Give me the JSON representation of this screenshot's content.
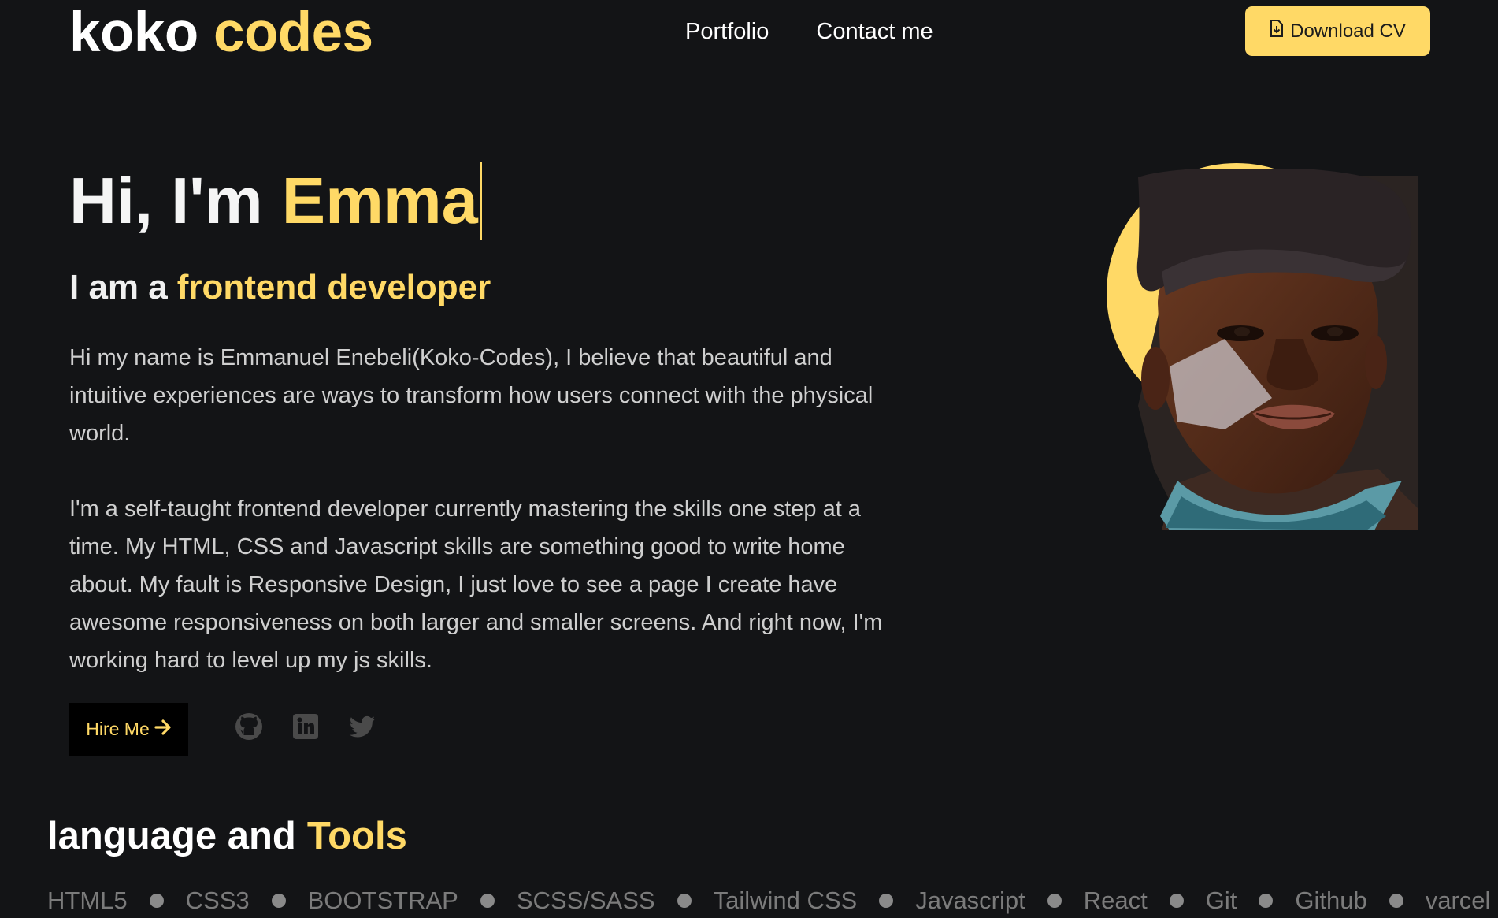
{
  "header": {
    "logo_first": "koko",
    "logo_accent": "codes",
    "nav": [
      "Portfolio",
      "Contact me"
    ],
    "cv_button": "Download CV"
  },
  "hero": {
    "greeting": "Hi, I'm",
    "typed_name": "Emma",
    "role_prefix": "I am a",
    "role": "frontend developer",
    "bio_1": "Hi my name is Emmanuel Enebeli(Koko-Codes), I believe that beautiful and intuitive experiences are ways to transform how users connect with the physical world.",
    "bio_2": "I'm a self-taught frontend developer currently mastering the skills one step at a time. My HTML, CSS and Javascript skills are something good to write home about. My fault is Responsive Design, I just love to see a page I create have awesome responsiveness on both larger and smaller screens. And right now, I'm working hard to level up my js skills.",
    "hire_button": "Hire Me",
    "socials": [
      "github-icon",
      "linkedin-icon",
      "twitter-icon"
    ]
  },
  "tools": {
    "title_first": "language and",
    "title_accent": "Tools",
    "items": [
      "HTML5",
      "CSS3",
      "BOOTSTRAP",
      "SCSS/SASS",
      "Tailwind CSS",
      "Javascript",
      "React",
      "Git",
      "Github",
      "varcel"
    ]
  },
  "colors": {
    "background": "#131416",
    "accent": "#ffd966",
    "text": "#f2f2f2",
    "muted": "#7b7b7b"
  }
}
